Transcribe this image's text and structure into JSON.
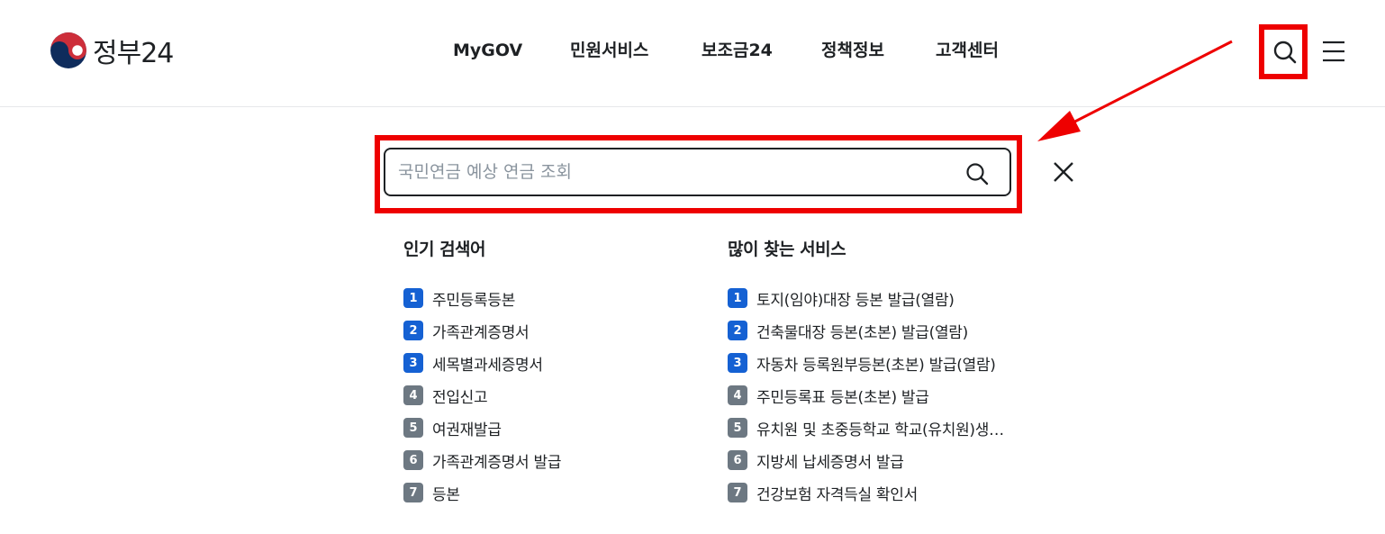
{
  "header": {
    "logo_text": "정부24",
    "nav": [
      "MyGOV",
      "민원서비스",
      "보조금24",
      "정책정보",
      "고객센터"
    ],
    "icons": {
      "search": "search-icon",
      "menu": "hamburger-menu-icon",
      "logo": "taegeuk-emblem-icon"
    }
  },
  "search": {
    "placeholder": "국민연금 예상 연금 조회",
    "submit_icon": "search-icon",
    "close_icon": "close-icon"
  },
  "popular": {
    "title": "인기 검색어",
    "items": [
      "주민등록등본",
      "가족관계증명서",
      "세목별과세증명서",
      "전입신고",
      "여권재발급",
      "가족관계증명서 발급",
      "등본"
    ]
  },
  "services": {
    "title": "많이 찾는 서비스",
    "items": [
      "토지(임야)대장 등본 발급(열람)",
      "건축물대장 등본(초본) 발급(열람)",
      "자동차 등록원부등본(초본) 발급(열람)",
      "주민등록표 등본(초본) 발급",
      "유치원 및 초중등학교 학교(유치원)생…",
      "지방세 납세증명서 발급",
      "건강보험 자격득실 확인서"
    ]
  },
  "ranks": [
    "1",
    "2",
    "3",
    "4",
    "5",
    "6",
    "7"
  ],
  "colors": {
    "rank_top": "#1561d3",
    "rank_rest": "#6d7882",
    "highlight": "#ee0000",
    "text": "#1e2124",
    "placeholder": "#8a949e",
    "divider": "#e6e8ea",
    "logo_red": "#cd2e3a",
    "logo_blue": "#0f2c5c"
  }
}
